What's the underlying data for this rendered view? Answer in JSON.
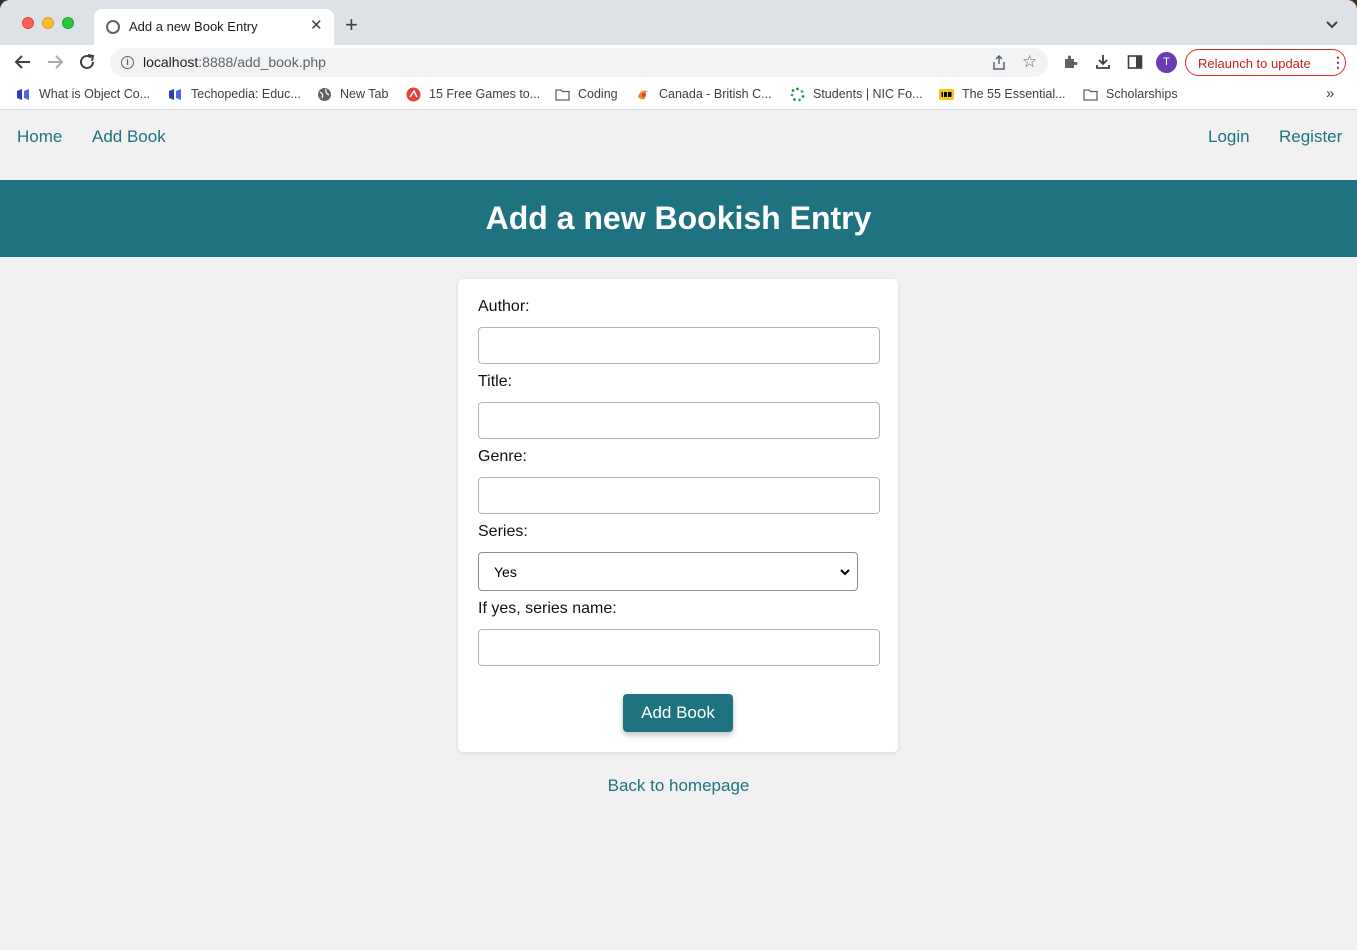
{
  "browser": {
    "tab_title": "Add a new Book Entry",
    "tab_close": "✕",
    "new_tab": "+",
    "url_host": "localhost",
    "url_rest": ":8888/add_book.php",
    "relaunch_label": "Relaunch to update",
    "relaunch_menu": "⋮",
    "avatar_initial": "T",
    "bookmarks": [
      {
        "label": "What is Object Co...",
        "icon": "blue-cube-icon"
      },
      {
        "label": "Techopedia: Educ...",
        "icon": "blue-cube-icon"
      },
      {
        "label": "New Tab",
        "icon": "globe-icon"
      },
      {
        "label": "15 Free Games to...",
        "icon": "red-circle-icon"
      },
      {
        "label": "Coding",
        "icon": "folder-icon"
      },
      {
        "label": "Canada - British C...",
        "icon": "orange-swirl-icon"
      },
      {
        "label": "Students | NIC Fo...",
        "icon": "dots-loader-icon"
      },
      {
        "label": "The 55 Essential...",
        "icon": "imdb-icon"
      },
      {
        "label": "Scholarships",
        "icon": "folder-icon"
      }
    ],
    "bookmarks_more": "»"
  },
  "nav": {
    "home": "Home",
    "add_book": "Add Book",
    "login": "Login",
    "register": "Register"
  },
  "hero": {
    "title": "Add a new Bookish Entry"
  },
  "form": {
    "author_label": "Author:",
    "title_label": "Title:",
    "genre_label": "Genre:",
    "series_label": "Series:",
    "series_value": "Yes",
    "series_name_label": "If yes, series name:",
    "submit_label": "Add Book"
  },
  "back_link": "Back to homepage",
  "colors": {
    "accent": "#1f7380",
    "page_bg": "#f1f1f1",
    "relaunch": "#c5221f"
  }
}
